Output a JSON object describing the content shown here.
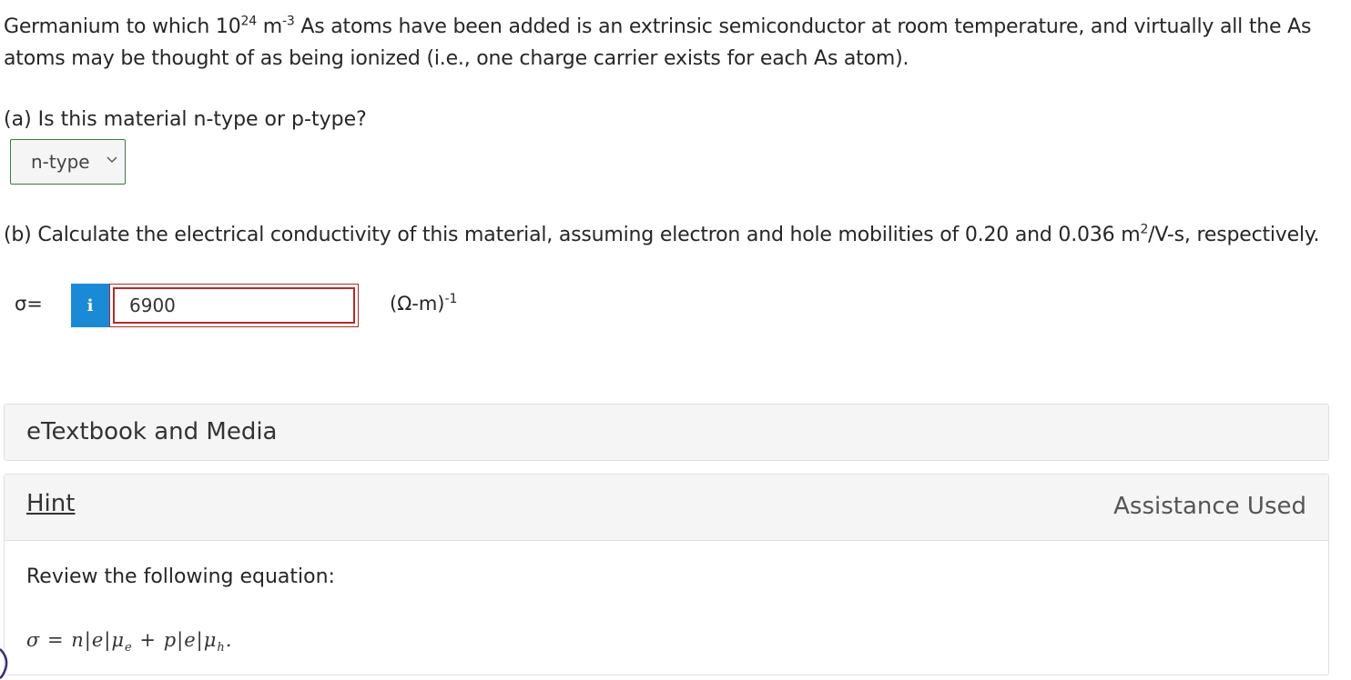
{
  "question": {
    "intro_part1": "Germanium to which 10",
    "intro_exp1": "24",
    "intro_part2": " m",
    "intro_exp2": "-3",
    "intro_part3": " As atoms have been added is an extrinsic semiconductor at room temperature, and virtually all the As atoms may be thought of as being ionized (i.e., one charge carrier exists for each As atom)."
  },
  "part_a": {
    "prompt": "(a) Is this material n-type or p-type?",
    "selected_value": "n-type"
  },
  "part_b": {
    "prompt_part1": "(b) Calculate the electrical conductivity of this material, assuming electron and hole mobilities of 0.20 and 0.036 m",
    "prompt_exp": "2",
    "prompt_part2": "/V-s, respectively.",
    "symbol_label": "σ=",
    "info_icon_glyph": "i",
    "answer_value": "6900",
    "unit_text": "(Ω-m)",
    "unit_exp": "-1"
  },
  "etextbook": {
    "title": "eTextbook and Media"
  },
  "hint": {
    "link_label": "Hint",
    "status": "Assistance Used",
    "text": "Review the following equation:",
    "equation": "σ = n|e|μ"
  },
  "colors": {
    "info_button": "#1b8ad6",
    "answer_border_incorrect": "#b22a2a",
    "select_border": "#3b7d3b",
    "panel_bg": "#f5f5f5"
  }
}
